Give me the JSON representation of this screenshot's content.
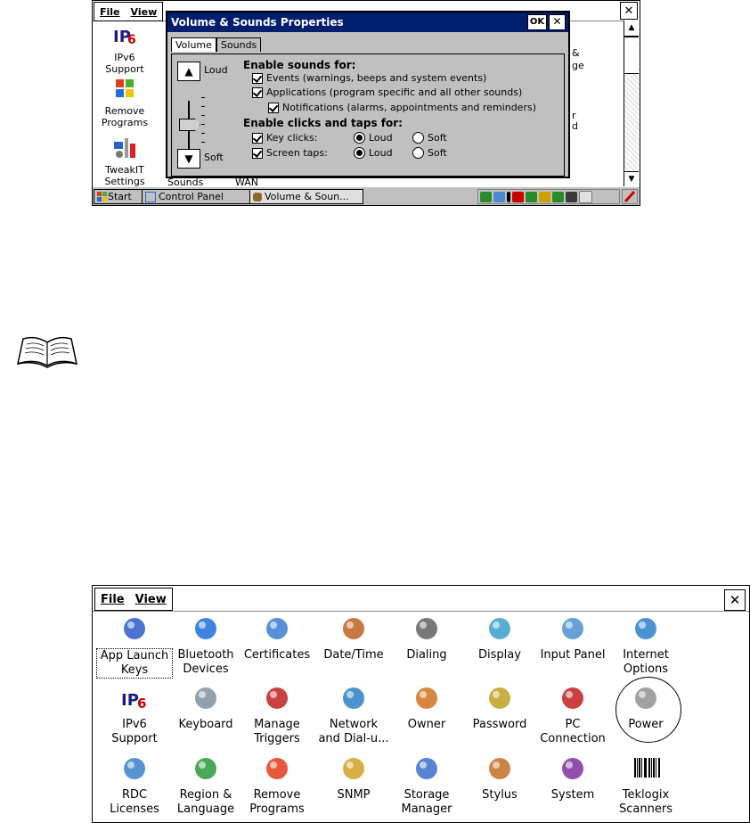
{
  "screen1": {
    "menu": [
      "File",
      "View"
    ],
    "close": "✕",
    "left_items": [
      {
        "label": "IPv6\nSupport",
        "icon": "ipv6-icon"
      },
      {
        "label": "Remove\nPrograms",
        "icon": "windows-flag-icon"
      },
      {
        "label": "TweakIT\nSettings",
        "icon": "tweakit-icon"
      }
    ],
    "partial_labels": [
      "Sounds",
      "WAN",
      "&",
      "ge",
      "r",
      "d"
    ],
    "dialog": {
      "title": "Volume & Sounds Properties",
      "ok": "OK",
      "close": "✕",
      "tabs": [
        "Volume",
        "Sounds"
      ],
      "loud": "Loud",
      "soft": "Soft",
      "up_arrow": "▲",
      "down_arrow": "▼",
      "enable_sounds_header": "Enable sounds for:",
      "events": "Events (warnings, beeps and system events)",
      "applications": "Applications (program specific and all other sounds)",
      "notifications": "Notifications (alarms, appointments and reminders)",
      "enable_clicks_header": "Enable clicks and taps for:",
      "key_clicks": "Key clicks:",
      "screen_taps": "Screen taps:",
      "radio_loud": "Loud",
      "radio_soft": "Soft"
    },
    "taskbar": {
      "start": "Start",
      "control_panel": "Control Panel",
      "volume": "Volume & Soun..."
    }
  },
  "screen2": {
    "menu": [
      "File",
      "View"
    ],
    "close": "✕",
    "rows": [
      [
        "App Launch\nKeys",
        "Bluetooth\nDevices",
        "Certificates",
        "Date/Time",
        "Dialing",
        "Display",
        "Input Panel",
        "Internet\nOptions"
      ],
      [
        "IPv6\nSupport",
        "Keyboard",
        "Manage\nTriggers",
        "Network\nand Dial-u...",
        "Owner",
        "Password",
        "PC\nConnection",
        "Power"
      ],
      [
        "RDC\nLicenses",
        "Region &\nLanguage",
        "Remove\nPrograms",
        "SNMP",
        "Storage\nManager",
        "Stylus",
        "System",
        "Teklogix\nScanners"
      ]
    ]
  }
}
